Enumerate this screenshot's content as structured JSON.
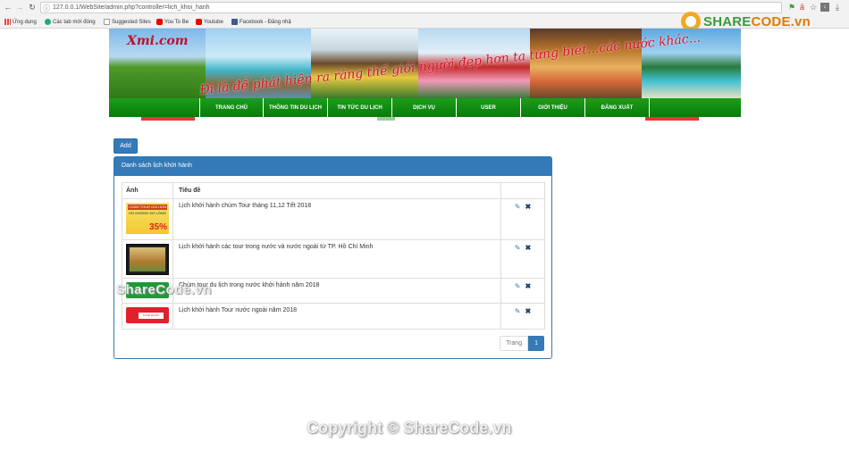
{
  "browser": {
    "url": "127.0.0.1/WebSite/admin.php?controller=lich_khoi_hanh",
    "bookmarks": [
      "Ứng dụng",
      "Các tab mới đóng",
      "Suggested Sites",
      "You To Be",
      "Youtube",
      "Facebook - Đăng nhậ"
    ]
  },
  "brand": {
    "share": "SHARE",
    "code": "CODE.vn"
  },
  "banner": {
    "logo": "Xmi.com",
    "slogan": "Đi là để phát hiện ra rằng thế giới người đẹp hơn ta từng biết...các nước khác..."
  },
  "menu": [
    "TRANG CHỦ",
    "THÔNG TIN DU LỊCH",
    "TIN TỨC DU LỊCH",
    "DỊCH VỤ",
    "USER",
    "GIỚI THIỆU",
    "ĐĂNG XUẤT"
  ],
  "add_label": "Add",
  "panel": {
    "title": "Danh sách lịch khởi hành",
    "col_image": "Ảnh",
    "col_title": "Tiêu đề",
    "rows": [
      {
        "title": "Lịch khởi hành chùm Tour tháng 11,12 Tết 2018",
        "thumb": "promo"
      },
      {
        "title": "Lịch khởi hành các tour trong nước và nước ngoài từ TP. Hồ Chí Minh",
        "thumb": "photo"
      },
      {
        "title": "Chùm tour du lịch trong nước khởi hành năm 2018",
        "thumb": "green"
      },
      {
        "title": "Lịch khởi hành Tour nước ngoài năm 2018",
        "thumb": "red"
      }
    ],
    "thumb_texts": {
      "promo_top": "CHÙM TOUR GIÁ HỜN",
      "promo_mid": "ƯU KHÔNG SỢ LỖNG",
      "promo_pct": "35%",
      "red_label": "TOUR NƯỚC NGOÀI"
    },
    "pager_label": "Trang",
    "pager_page": "1"
  },
  "watermark": {
    "inline": "ShareCode.vn",
    "footer": "Copyright © ShareCode.vn"
  },
  "colors": {
    "primary": "#337ab7",
    "menu_green": "#0a7a0a"
  }
}
